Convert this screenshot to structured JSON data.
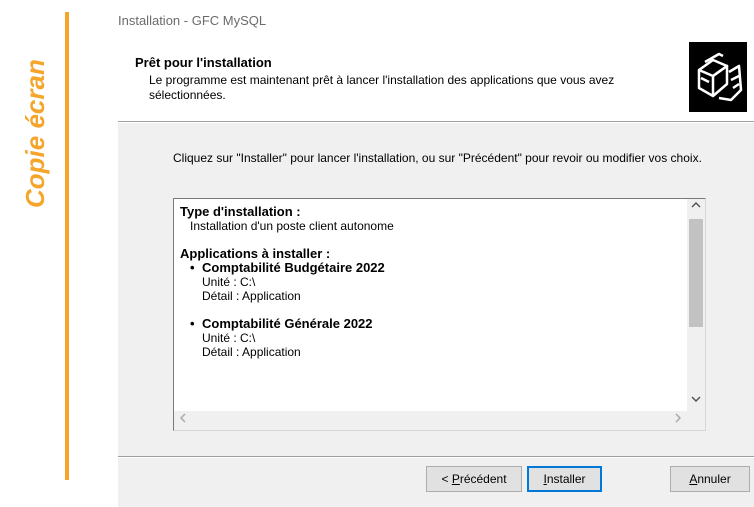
{
  "side": {
    "label": "Copie écran"
  },
  "window": {
    "title": "Installation - GFC MySQL"
  },
  "header": {
    "title": "Prêt pour l'installation",
    "description": "Le programme est maintenant prêt à lancer l'installation des applications que vous avez sélectionnées."
  },
  "instructions": "Cliquez sur \"Installer\" pour lancer l'installation, ou sur \"Précédent\" pour revoir ou modifier vos choix.",
  "memo": {
    "type_heading": "Type d'installation :",
    "type_value": "Installation d'un poste client autonome",
    "apps_heading": "Applications à installer :",
    "apps": [
      {
        "name": "Comptabilité Budgétaire 2022",
        "unit": "Unité : C:\\",
        "detail": "Détail : Application"
      },
      {
        "name": "Comptabilité Générale 2022",
        "unit": "Unité : C:\\",
        "detail": "Détail : Application"
      }
    ]
  },
  "buttons": {
    "prev_pre": "< ",
    "prev_key": "P",
    "prev_rest": "récédent",
    "install_key": "I",
    "install_rest": "nstaller",
    "cancel_key": "A",
    "cancel_rest": "nnuler"
  },
  "colors": {
    "accent_bar": "#f4a52a",
    "side_text": "#f4a52a",
    "focus_border": "#0078d7"
  },
  "icons": {
    "scroll_up": "chevron-up",
    "scroll_down": "chevron-down",
    "scroll_left": "chevron-left",
    "scroll_right": "chevron-right",
    "logo": "install-boxes-icon"
  }
}
